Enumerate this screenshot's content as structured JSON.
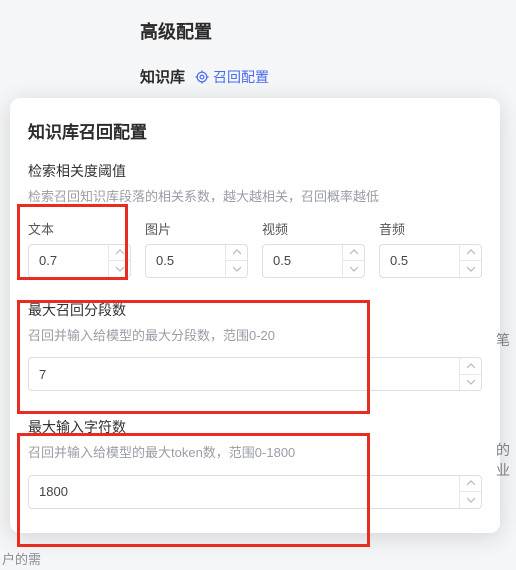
{
  "header": {
    "title": "高级配置",
    "kb_label": "知识库",
    "link_text": "召回配置"
  },
  "panel": {
    "title": "知识库召回配置",
    "relevance": {
      "label": "检索相关度阈值",
      "desc": "检索召回知识库段落的相关系数，越大越相关，召回概率越低",
      "cols": [
        {
          "label": "文本",
          "value": "0.7"
        },
        {
          "label": "图片",
          "value": "0.5"
        },
        {
          "label": "视频",
          "value": "0.5"
        },
        {
          "label": "音频",
          "value": "0.5"
        }
      ]
    },
    "max_segments": {
      "label": "最大召回分段数",
      "desc": "召回并输入给模型的最大分段数，范围0-20",
      "value": "7"
    },
    "max_chars": {
      "label": "最大输入字符数",
      "desc": "召回并输入给模型的最大token数，范围0-1800",
      "value": "1800"
    }
  },
  "bg": {
    "side1": "笔",
    "side2": "的业",
    "footer": "户的需"
  }
}
